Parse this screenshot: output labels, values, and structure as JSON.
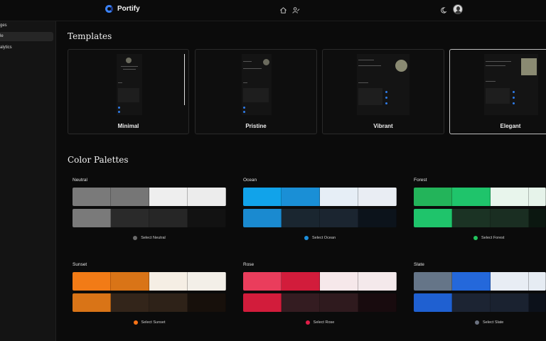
{
  "app": {
    "name": "Portify"
  },
  "sidebar": {
    "items": [
      {
        "label": "ges"
      },
      {
        "label": "le"
      },
      {
        "label": "alytics"
      }
    ]
  },
  "templates": {
    "title": "Templates",
    "items": [
      {
        "label": "Minimal"
      },
      {
        "label": "Pristine"
      },
      {
        "label": "Vibrant"
      },
      {
        "label": "Elegant"
      }
    ],
    "selected": "Elegant"
  },
  "palettes": {
    "title": "Color Palettes",
    "items": [
      {
        "name": "Neutral",
        "select_label": "Select Neutral",
        "dot": "#6b6b6b",
        "row1": [
          "#7a7a7a",
          "#767676",
          "#eeeeee",
          "#ececec"
        ],
        "row2": [
          "#7a7a7a",
          "#2a2a2a",
          "#262626",
          "#121212"
        ]
      },
      {
        "name": "Ocean",
        "select_label": "Select Ocean",
        "dot": "#1d8fdc",
        "row1": [
          "#11a3ea",
          "#1a8fd6",
          "#e6eef6",
          "#e9edf3"
        ],
        "row2": [
          "#1a8ad0",
          "#1a2630",
          "#1b2530",
          "#0c131b"
        ]
      },
      {
        "name": "Forest",
        "select_label": "Select Forest",
        "dot": "#22c55e",
        "row1": [
          "#23b45a",
          "#1fc46b",
          "#e8f5ec",
          "#e6f3ea"
        ],
        "row2": [
          "#1fc46b",
          "#1b3324",
          "#1a2e22",
          "#0b1710"
        ]
      },
      {
        "name": "Sunset",
        "select_label": "Select Sunset",
        "dot": "#f97316",
        "row1": [
          "#f27b16",
          "#d97417",
          "#f5eee4",
          "#f3efe8"
        ],
        "row2": [
          "#d97417",
          "#33251a",
          "#2e2218",
          "#17100b"
        ]
      },
      {
        "name": "Rose",
        "select_label": "Select Rose",
        "dot": "#e11d48",
        "row1": [
          "#ea3d5c",
          "#d21c3b",
          "#f6e8ea",
          "#f4e9eb"
        ],
        "row2": [
          "#d21c3b",
          "#341c21",
          "#2f1a1e",
          "#180b0e"
        ]
      },
      {
        "name": "Slate",
        "select_label": "Select Slate",
        "dot": "#6b7280",
        "row1": [
          "#657588",
          "#2468db",
          "#e8edf4",
          "#e6ecf3"
        ],
        "row2": [
          "#1f60d1",
          "#1c2433",
          "#1a2230",
          "#0c111a"
        ]
      }
    ]
  },
  "icons": {
    "home": "home-icon",
    "user_edit": "user-edit-icon",
    "theme": "moon-icon",
    "avatar": "avatar"
  },
  "colors": {
    "accent": "#3b82f6",
    "bg": "#0b0b0b",
    "sidebar": "#141414"
  }
}
